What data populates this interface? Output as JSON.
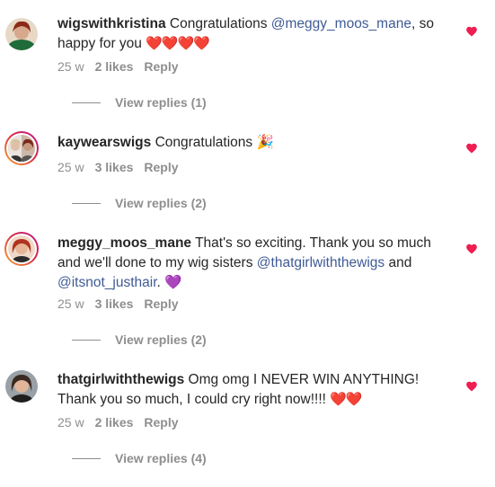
{
  "comments": [
    {
      "username": "wigswithkristina",
      "text_before": "Congratulations ",
      "mention": "@meggy_moos_mane",
      "text_after": ", so happy for you ",
      "emoji": "❤️❤️❤️❤️",
      "time": "25 w",
      "likes": "2 likes",
      "reply": "Reply",
      "view_replies": "View replies (1)"
    },
    {
      "username": "kaywearswigs",
      "text_before": "Congratulations ",
      "emoji": "🎉",
      "time": "25 w",
      "likes": "3 likes",
      "reply": "Reply",
      "view_replies": "View replies (2)"
    },
    {
      "username": "meggy_moos_mane",
      "text_line1": "That's so exciting. Thank you so much and we'll done to my wig sisters ",
      "mention1": "@thatgirlwiththewigs",
      "text_mid": " and ",
      "mention2": "@itsnot_justhair",
      "text_after": ". ",
      "emoji": "💜",
      "time": "25 w",
      "likes": "3 likes",
      "reply": "Reply",
      "view_replies": "View replies (2)"
    },
    {
      "username": "thatgirlwiththewigs",
      "text": "Omg omg I NEVER WIN ANYTHING! Thank you so much, I could cry right now!!!! ",
      "emoji": "❤️❤️",
      "time": "25 w",
      "likes": "2 likes",
      "reply": "Reply",
      "view_replies": "View replies (4)"
    }
  ],
  "colors": {
    "like_heart": "#ee1d52",
    "mention": "#3f5b95",
    "meta": "#8e8e8e"
  }
}
